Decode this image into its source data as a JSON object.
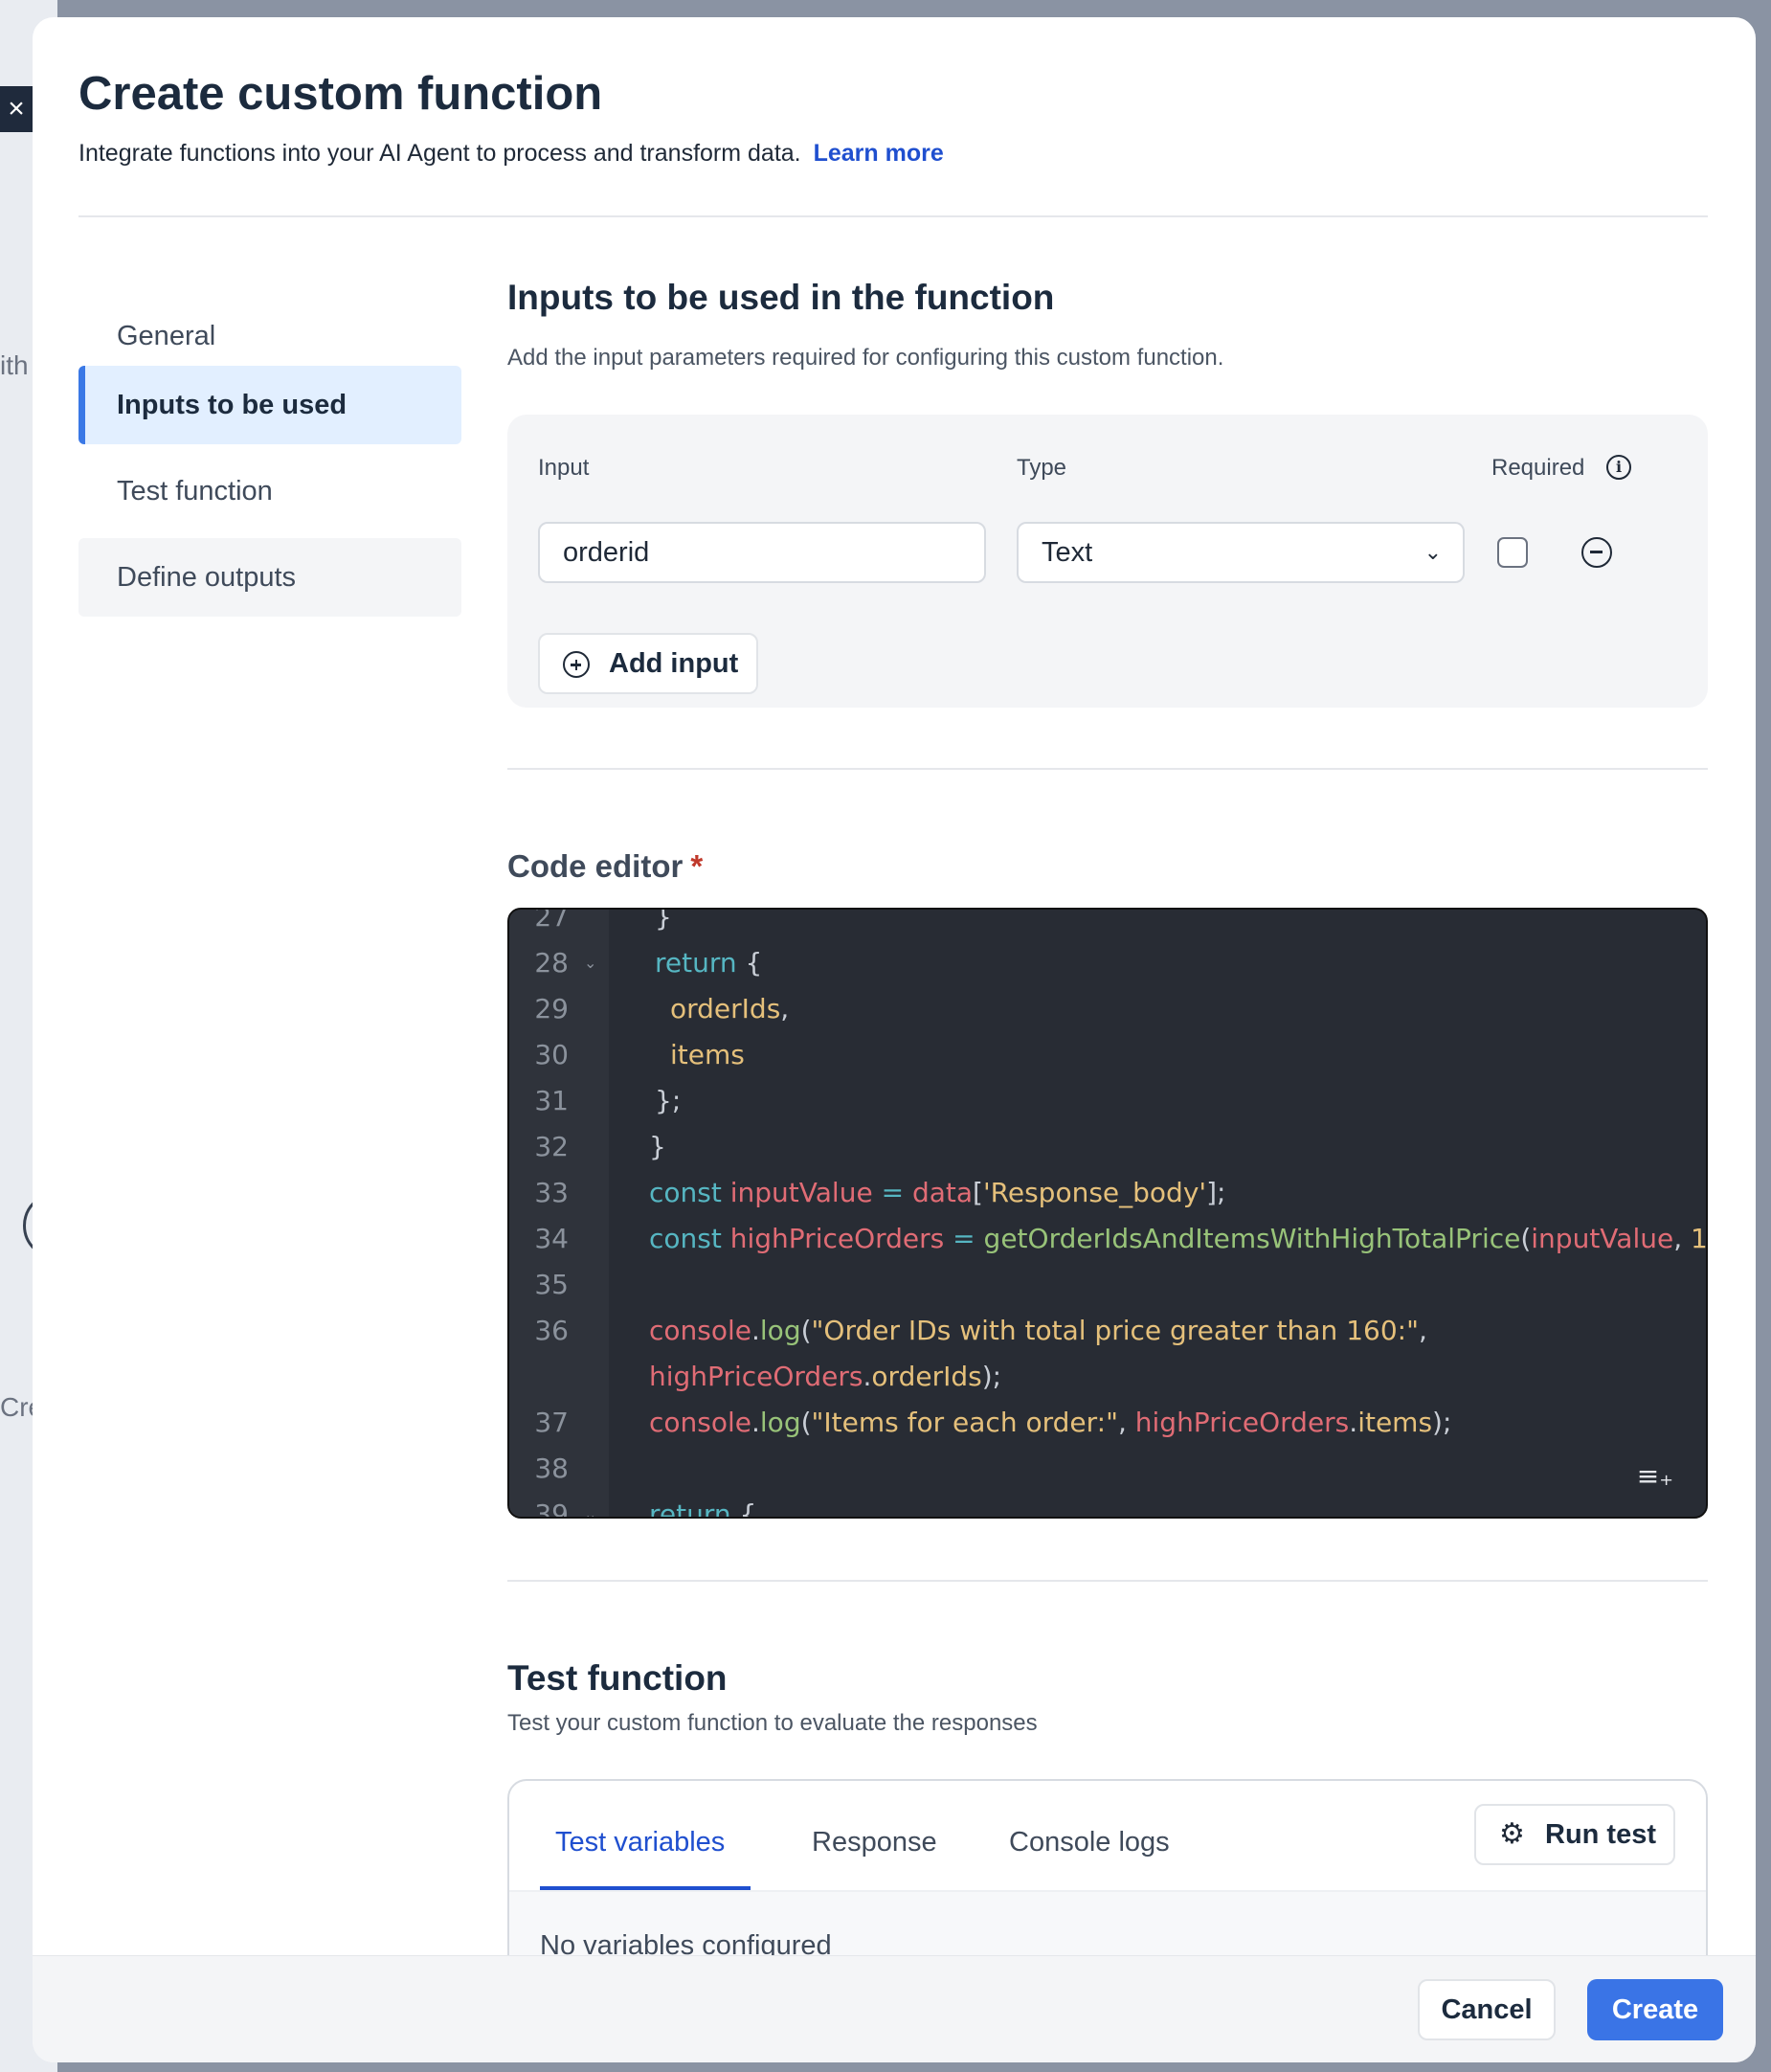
{
  "background": {
    "close_glyph": "×",
    "frag_with": "ith",
    "frag_create": "Cre"
  },
  "modal": {
    "title": "Create custom function",
    "subtitle": "Integrate functions into your AI Agent to process and transform data.",
    "learn_more": "Learn more"
  },
  "nav": {
    "items": [
      {
        "label": "General"
      },
      {
        "label": "Inputs to be used"
      },
      {
        "label": "Test function"
      },
      {
        "label": "Define outputs"
      }
    ]
  },
  "inputs_section": {
    "title": "Inputs to be used in the function",
    "description": "Add the input parameters required for configuring this custom function.",
    "col_input": "Input",
    "col_type": "Type",
    "col_required": "Required",
    "input_value": "orderid",
    "type_value": "Text",
    "add_input_label": "Add input",
    "info_icon": "info-icon",
    "chevron_icon": "chevron-down-icon"
  },
  "code_editor": {
    "label": "Code editor",
    "required_mark": "*",
    "line_numbers": [
      "27",
      "28",
      "29",
      "30",
      "31",
      "32",
      "33",
      "34",
      "35",
      "36",
      "",
      "37",
      "38",
      "39"
    ],
    "wrap_icon": "≡₊"
  },
  "test_section": {
    "title": "Test function",
    "description": "Test your custom function to evaluate the responses",
    "tabs": [
      {
        "label": "Test variables"
      },
      {
        "label": "Response"
      },
      {
        "label": "Console logs"
      }
    ],
    "run_test_label": "Run test",
    "empty_message": "No variables configured"
  },
  "footer": {
    "cancel_label": "Cancel",
    "create_label": "Create"
  },
  "colors": {
    "accent": "#3a74e6",
    "link": "#1f4fcf",
    "editor_bg": "#282c34",
    "required": "#c0392b"
  }
}
